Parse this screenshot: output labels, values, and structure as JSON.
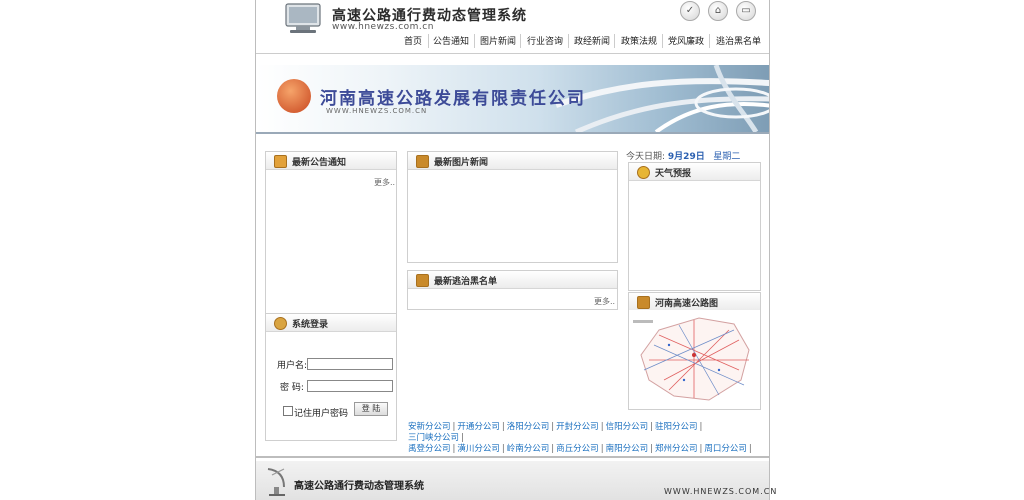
{
  "header": {
    "title": "高速公路通行费动态管理系统",
    "url": "www.hnewzs.com.cn"
  },
  "nav": {
    "items": [
      {
        "label": "首页"
      },
      {
        "label": "公告通知"
      },
      {
        "label": "图片新闻"
      },
      {
        "label": "行业咨询"
      },
      {
        "label": "政经新闻"
      },
      {
        "label": "政策法规"
      },
      {
        "label": "党风廉政"
      },
      {
        "label": "逃治黑名单"
      }
    ]
  },
  "banner": {
    "company": "河南高速公路发展有限责任公司",
    "url": "WWW.HNEWZS.COM.CN"
  },
  "notices": {
    "title": "最新公告通知",
    "more": "更多.."
  },
  "photo_news": {
    "title": "最新图片新闻"
  },
  "blacklist": {
    "title": "最新逃治黑名单",
    "more": "更多.."
  },
  "date": {
    "label": "今天日期:",
    "value": "9月29日",
    "weekday": "星期二"
  },
  "weather": {
    "title": "天气预报"
  },
  "highway_map": {
    "title": "河南高速公路图"
  },
  "login": {
    "title": "系统登录",
    "username_label": "用户名:",
    "password_label": "密  码:",
    "remember_label": "记住用户密码",
    "submit_label": "登 陆"
  },
  "branches": [
    "安新分公司",
    "开通分公司",
    "洛阳分公司",
    "开封分公司",
    "信阳分公司",
    "驻阳分公司",
    "三门峡分公司",
    "禹登分公司",
    "潢川分公司",
    "岭南分公司",
    "商丘分公司",
    "南阳分公司",
    "郑州分公司",
    "周口分公司"
  ],
  "footer": {
    "title": "高速公路通行费动态管理系统",
    "url": "WWW.HNEWZS.COM.CN"
  },
  "colors": {
    "link": "#1a6fbf",
    "banner_text": "#3d4b98",
    "panel_icon": "#e2a13a"
  }
}
